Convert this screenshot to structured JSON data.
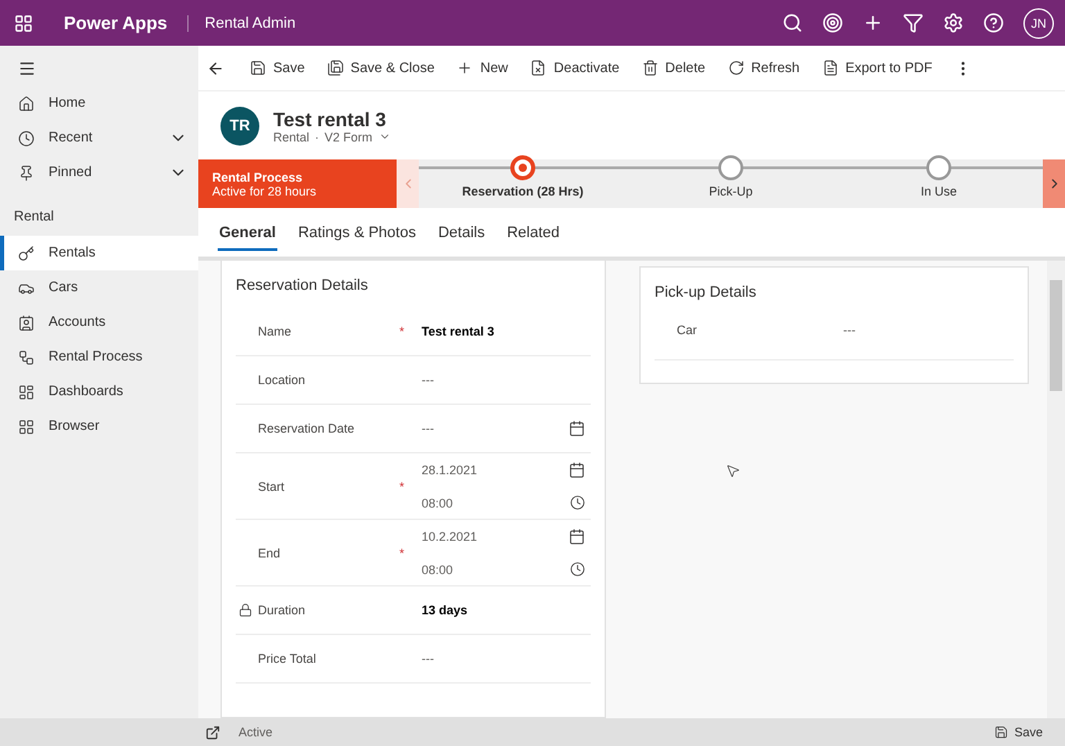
{
  "app_bar": {
    "app_name": "Power Apps",
    "area": "Rental Admin",
    "user_initials": "JN"
  },
  "sidebar": {
    "top_items": [
      {
        "label": "Home",
        "kind": "link"
      },
      {
        "label": "Recent",
        "kind": "group"
      },
      {
        "label": "Pinned",
        "kind": "group"
      }
    ],
    "group_title": "Rental",
    "items": [
      {
        "label": "Rentals",
        "selected": true
      },
      {
        "label": "Cars",
        "selected": false
      },
      {
        "label": "Accounts",
        "selected": false
      },
      {
        "label": "Rental Process",
        "selected": false
      },
      {
        "label": "Dashboards",
        "selected": false
      },
      {
        "label": "Browser",
        "selected": false
      }
    ]
  },
  "command_bar": [
    {
      "label": "Save"
    },
    {
      "label": "Save & Close"
    },
    {
      "label": "New"
    },
    {
      "label": "Deactivate"
    },
    {
      "label": "Delete"
    },
    {
      "label": "Refresh"
    },
    {
      "label": "Export to PDF"
    }
  ],
  "record": {
    "initials": "TR",
    "title": "Test rental 3",
    "entity": "Rental",
    "separator": "·",
    "form": "V2 Form"
  },
  "process": {
    "name": "Rental Process",
    "status": "Active for 28 hours",
    "stages": [
      {
        "label": "Reservation  (28 Hrs)",
        "selected": true
      },
      {
        "label": "Pick-Up",
        "selected": false
      },
      {
        "label": "In Use",
        "selected": false
      }
    ]
  },
  "tabs": [
    {
      "label": "General",
      "selected": true
    },
    {
      "label": "Ratings & Photos",
      "selected": false
    },
    {
      "label": "Details",
      "selected": false
    },
    {
      "label": "Related",
      "selected": false
    }
  ],
  "reservation": {
    "title": "Reservation Details",
    "fields": [
      {
        "kind": "text",
        "label": "Name",
        "required_mark": "*",
        "value": "Test rental 3"
      },
      {
        "kind": "empty",
        "label": "Location",
        "value": "---"
      },
      {
        "kind": "date",
        "label": "Reservation Date",
        "value": "---"
      },
      {
        "kind": "datetime",
        "label": "Start",
        "required_mark": "*",
        "date": "28.1.2021",
        "time": "08:00"
      },
      {
        "kind": "datetime",
        "label": "End",
        "required_mark": "*",
        "date": "10.2.2021",
        "time": "08:00"
      },
      {
        "kind": "locked",
        "label": "Duration",
        "value": "13 days"
      },
      {
        "kind": "empty",
        "label": "Price Total",
        "value": "---"
      }
    ]
  },
  "pickup": {
    "title": "Pick-up Details",
    "fields": [
      {
        "label": "Car",
        "value": "---"
      }
    ]
  },
  "status_bar": {
    "status": "Active",
    "save_label": "Save"
  }
}
